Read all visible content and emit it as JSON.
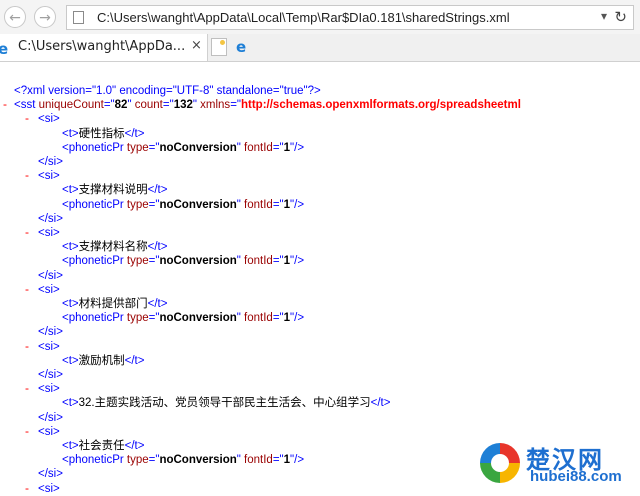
{
  "address_bar": {
    "url": "C:\\Users\\wanght\\AppData\\Local\\Temp\\Rar$DIa0.181\\sharedStrings.xml"
  },
  "tab": {
    "title": "C:\\Users\\wanght\\AppDa...",
    "close": "×"
  },
  "xml": {
    "declaration": "<?xml version=\"1.0\" encoding=\"UTF-8\" standalone=\"true\"?>",
    "sst_open": "<sst ",
    "sst_attr1_name": "uniqueCount",
    "sst_attr1_value": "82",
    "sst_attr2_name": "count",
    "sst_attr2_value": "132",
    "sst_attr3_name": "xmlns",
    "sst_attr3_value": "http://schemas.openxmlformats.org/spreadsheetml",
    "si_open": "<si>",
    "si_close": "</si>",
    "t_open": "<t>",
    "t_close": "</t>",
    "phonetic_tag": "<phoneticPr ",
    "phonetic_type_name": "type",
    "phonetic_type_value": "noConversion",
    "phonetic_font_name": "fontId",
    "phonetic_font_value": "1",
    "phonetic_end": "/>",
    "collapse_symbol": "-",
    "entries": [
      {
        "text": "硬性指标",
        "has_phonetic": true
      },
      {
        "text": "支撑材料说明",
        "has_phonetic": true
      },
      {
        "text": "支撑材料名称",
        "has_phonetic": true
      },
      {
        "text": "材料提供部门",
        "has_phonetic": true
      },
      {
        "text": "激励机制",
        "has_phonetic": false
      },
      {
        "text": "32.主题实践活动、党员领导干部民主生活会、中心组学习",
        "has_phonetic": false
      },
      {
        "text": "社会责任",
        "has_phonetic": true
      }
    ]
  },
  "watermark": {
    "name": "楚汉网",
    "domain": "hubei88.com"
  }
}
